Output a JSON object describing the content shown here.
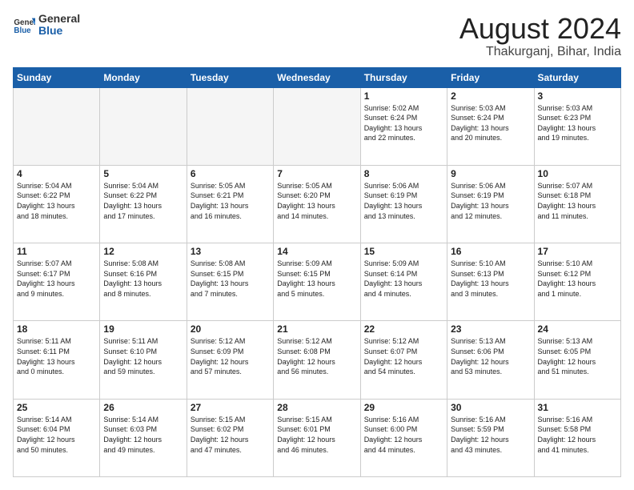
{
  "logo": {
    "general": "General",
    "blue": "Blue"
  },
  "title": {
    "month_year": "August 2024",
    "location": "Thakurganj, Bihar, India"
  },
  "weekdays": [
    "Sunday",
    "Monday",
    "Tuesday",
    "Wednesday",
    "Thursday",
    "Friday",
    "Saturday"
  ],
  "weeks": [
    [
      {
        "day": "",
        "info": ""
      },
      {
        "day": "",
        "info": ""
      },
      {
        "day": "",
        "info": ""
      },
      {
        "day": "",
        "info": ""
      },
      {
        "day": "1",
        "info": "Sunrise: 5:02 AM\nSunset: 6:24 PM\nDaylight: 13 hours\nand 22 minutes."
      },
      {
        "day": "2",
        "info": "Sunrise: 5:03 AM\nSunset: 6:24 PM\nDaylight: 13 hours\nand 20 minutes."
      },
      {
        "day": "3",
        "info": "Sunrise: 5:03 AM\nSunset: 6:23 PM\nDaylight: 13 hours\nand 19 minutes."
      }
    ],
    [
      {
        "day": "4",
        "info": "Sunrise: 5:04 AM\nSunset: 6:22 PM\nDaylight: 13 hours\nand 18 minutes."
      },
      {
        "day": "5",
        "info": "Sunrise: 5:04 AM\nSunset: 6:22 PM\nDaylight: 13 hours\nand 17 minutes."
      },
      {
        "day": "6",
        "info": "Sunrise: 5:05 AM\nSunset: 6:21 PM\nDaylight: 13 hours\nand 16 minutes."
      },
      {
        "day": "7",
        "info": "Sunrise: 5:05 AM\nSunset: 6:20 PM\nDaylight: 13 hours\nand 14 minutes."
      },
      {
        "day": "8",
        "info": "Sunrise: 5:06 AM\nSunset: 6:19 PM\nDaylight: 13 hours\nand 13 minutes."
      },
      {
        "day": "9",
        "info": "Sunrise: 5:06 AM\nSunset: 6:19 PM\nDaylight: 13 hours\nand 12 minutes."
      },
      {
        "day": "10",
        "info": "Sunrise: 5:07 AM\nSunset: 6:18 PM\nDaylight: 13 hours\nand 11 minutes."
      }
    ],
    [
      {
        "day": "11",
        "info": "Sunrise: 5:07 AM\nSunset: 6:17 PM\nDaylight: 13 hours\nand 9 minutes."
      },
      {
        "day": "12",
        "info": "Sunrise: 5:08 AM\nSunset: 6:16 PM\nDaylight: 13 hours\nand 8 minutes."
      },
      {
        "day": "13",
        "info": "Sunrise: 5:08 AM\nSunset: 6:15 PM\nDaylight: 13 hours\nand 7 minutes."
      },
      {
        "day": "14",
        "info": "Sunrise: 5:09 AM\nSunset: 6:15 PM\nDaylight: 13 hours\nand 5 minutes."
      },
      {
        "day": "15",
        "info": "Sunrise: 5:09 AM\nSunset: 6:14 PM\nDaylight: 13 hours\nand 4 minutes."
      },
      {
        "day": "16",
        "info": "Sunrise: 5:10 AM\nSunset: 6:13 PM\nDaylight: 13 hours\nand 3 minutes."
      },
      {
        "day": "17",
        "info": "Sunrise: 5:10 AM\nSunset: 6:12 PM\nDaylight: 13 hours\nand 1 minute."
      }
    ],
    [
      {
        "day": "18",
        "info": "Sunrise: 5:11 AM\nSunset: 6:11 PM\nDaylight: 13 hours\nand 0 minutes."
      },
      {
        "day": "19",
        "info": "Sunrise: 5:11 AM\nSunset: 6:10 PM\nDaylight: 12 hours\nand 59 minutes."
      },
      {
        "day": "20",
        "info": "Sunrise: 5:12 AM\nSunset: 6:09 PM\nDaylight: 12 hours\nand 57 minutes."
      },
      {
        "day": "21",
        "info": "Sunrise: 5:12 AM\nSunset: 6:08 PM\nDaylight: 12 hours\nand 56 minutes."
      },
      {
        "day": "22",
        "info": "Sunrise: 5:12 AM\nSunset: 6:07 PM\nDaylight: 12 hours\nand 54 minutes."
      },
      {
        "day": "23",
        "info": "Sunrise: 5:13 AM\nSunset: 6:06 PM\nDaylight: 12 hours\nand 53 minutes."
      },
      {
        "day": "24",
        "info": "Sunrise: 5:13 AM\nSunset: 6:05 PM\nDaylight: 12 hours\nand 51 minutes."
      }
    ],
    [
      {
        "day": "25",
        "info": "Sunrise: 5:14 AM\nSunset: 6:04 PM\nDaylight: 12 hours\nand 50 minutes."
      },
      {
        "day": "26",
        "info": "Sunrise: 5:14 AM\nSunset: 6:03 PM\nDaylight: 12 hours\nand 49 minutes."
      },
      {
        "day": "27",
        "info": "Sunrise: 5:15 AM\nSunset: 6:02 PM\nDaylight: 12 hours\nand 47 minutes."
      },
      {
        "day": "28",
        "info": "Sunrise: 5:15 AM\nSunset: 6:01 PM\nDaylight: 12 hours\nand 46 minutes."
      },
      {
        "day": "29",
        "info": "Sunrise: 5:16 AM\nSunset: 6:00 PM\nDaylight: 12 hours\nand 44 minutes."
      },
      {
        "day": "30",
        "info": "Sunrise: 5:16 AM\nSunset: 5:59 PM\nDaylight: 12 hours\nand 43 minutes."
      },
      {
        "day": "31",
        "info": "Sunrise: 5:16 AM\nSunset: 5:58 PM\nDaylight: 12 hours\nand 41 minutes."
      }
    ]
  ]
}
